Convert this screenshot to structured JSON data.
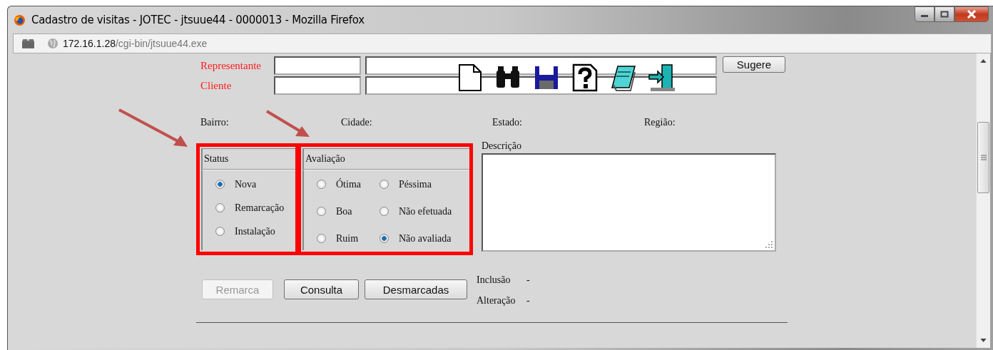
{
  "window": {
    "title": "Cadastro de visitas - JOTEC - jtsuue44 - 0000013 - Mozilla Firefox"
  },
  "address_bar": {
    "host": "172.16.1.28",
    "path": "/cgi-bin/jtsuue44.exe"
  },
  "lookup_fields": [
    {
      "label": "Representante"
    },
    {
      "label": "Cliente"
    }
  ],
  "suggest_button": {
    "label": "Sugere"
  },
  "location_labels": [
    "Bairro:",
    "Cidade:",
    "Estado:",
    "Região:"
  ],
  "status_group": {
    "title": "Status",
    "options": [
      {
        "label": "Nova",
        "selected": true
      },
      {
        "label": "Remarcação",
        "selected": false
      },
      {
        "label": "Instalação",
        "selected": false
      }
    ]
  },
  "evaluation_group": {
    "title": "Avaliação",
    "options": [
      {
        "label": "Ótima",
        "selected": false
      },
      {
        "label": "Péssima",
        "selected": false
      },
      {
        "label": "Boa",
        "selected": false
      },
      {
        "label": "Não efetuada",
        "selected": false
      },
      {
        "label": "Ruim",
        "selected": false
      },
      {
        "label": "Não avaliada",
        "selected": true
      }
    ]
  },
  "description": {
    "label": "Descrição"
  },
  "buttons": [
    {
      "label": "Remarca",
      "disabled": true
    },
    {
      "label": "Consulta",
      "disabled": false
    },
    {
      "label": "Desmarcadas",
      "disabled": false
    }
  ],
  "audit": [
    {
      "label": "Inclusão",
      "value": "-"
    },
    {
      "label": "Alteração",
      "value": "-"
    }
  ]
}
